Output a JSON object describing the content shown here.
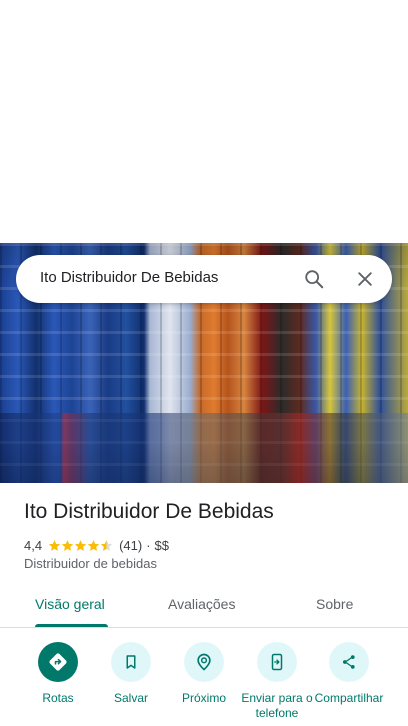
{
  "search": {
    "query": "Ito Distribuidor De Bebidas"
  },
  "place": {
    "name": "Ito Distribuidor De Bebidas",
    "rating": "4,4",
    "rating_stars": 4.4,
    "review_count": "(41)",
    "separator": "·",
    "price": "$$",
    "category": "Distribuidor de bebidas"
  },
  "tabs": [
    {
      "label": "Visão geral",
      "active": true
    },
    {
      "label": "Avaliações",
      "active": false
    },
    {
      "label": "Sobre",
      "active": false
    }
  ],
  "actions": [
    {
      "label": "Rotas",
      "icon": "directions-icon"
    },
    {
      "label": "Salvar",
      "icon": "bookmark-icon"
    },
    {
      "label": "Próximo",
      "icon": "nearby-icon"
    },
    {
      "label": "Enviar para o telefone",
      "icon": "send-to-phone-icon"
    },
    {
      "label": "Compartilhar",
      "icon": "share-icon"
    }
  ],
  "colors": {
    "accent": "#00796b",
    "action_bg": "#e0f7fa",
    "star": "#fbbc04"
  }
}
